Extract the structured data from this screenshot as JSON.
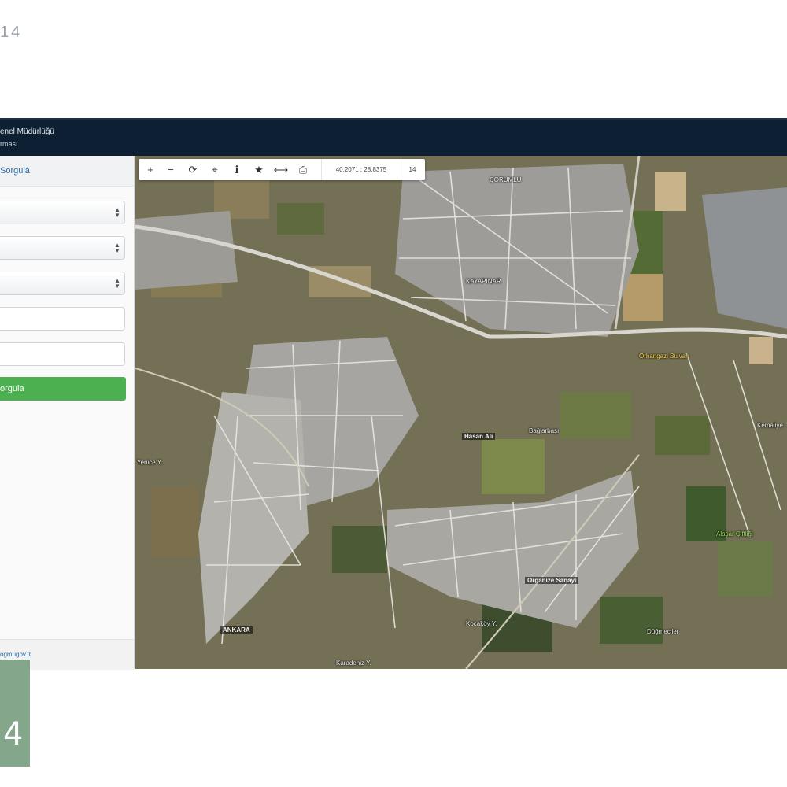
{
  "page": {
    "corner_number": "14"
  },
  "navbar": {
    "title_line1": "enel Müdürlüğü",
    "title_line2": "rması"
  },
  "sidebar": {
    "header": "Sorgulá",
    "query_button": "orgula",
    "footer_link": "ogmugov.tr"
  },
  "map": {
    "coordinates": "40.2071 : 28.8375",
    "zoom_level": "14",
    "labels": {
      "top_center": "ÇORUMLU",
      "center": "KAYAPINAR",
      "yellow_road": "Orhangazi Bulvarı",
      "middle": "Hasan Ali",
      "center_right": "Bağlarbaşı",
      "left": "Yenice Y.",
      "bottom_right": "Organize Sanayi",
      "bottom_left": "ANKARA",
      "bottom_street": "Kocaköy Y.",
      "bottom_edge": "Karadeniz Y.",
      "green": "Alaşar Çiftliği",
      "right_edge": "Kemaliye",
      "lower_right": "Düğmeciler"
    },
    "tool_icons": [
      "zoom-in-icon",
      "zoom-out-icon",
      "refresh-icon",
      "locate-icon",
      "info-icon",
      "star-icon",
      "measure-icon",
      "print-icon"
    ]
  },
  "brand": {
    "logo_glyph": "4",
    "logo_color": "#84a78b"
  },
  "colors": {
    "navbar": "#0d1f33",
    "query_button": "#4cb050",
    "link": "#2c6aa0"
  }
}
